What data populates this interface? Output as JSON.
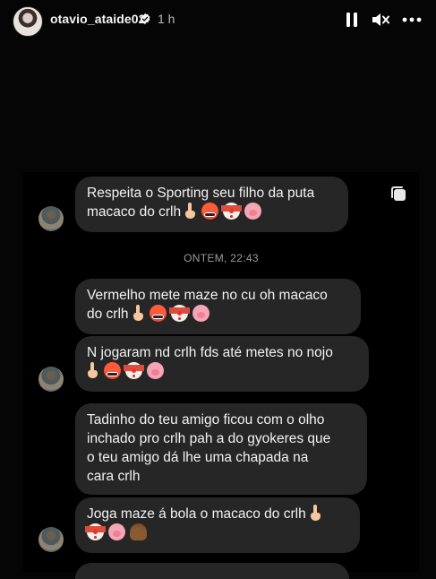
{
  "header": {
    "username": "otavio_ataide02",
    "time": "1 h"
  },
  "chat": {
    "timestamp": "ONTEM, 22:43",
    "messages": [
      {
        "lines": [
          "Respeita o Sporting seu filho da puta",
          "macaco do crlh"
        ]
      },
      {
        "lines": [
          "Vermelho mete maze no cu oh macaco",
          "do crlh"
        ]
      },
      {
        "lines": [
          "N jogaram nd crlh fds até metes no nojo"
        ]
      },
      {
        "lines": [
          "Tadinho do teu amigo ficou com o olho",
          "inchado pro crlh pah a do gyokeres que",
          "o teu amigo dá lhe uma chapada na",
          "cara crlh"
        ]
      },
      {
        "lines": [
          "Joga maze á bola o macaco do crlh"
        ]
      }
    ]
  },
  "colors": {
    "bubble": "#262626",
    "background": "#000000",
    "verified": "#3897f0"
  },
  "icons": [
    "pause-icon",
    "mute-icon",
    "more-icon",
    "verified-icon",
    "copy-icon"
  ]
}
